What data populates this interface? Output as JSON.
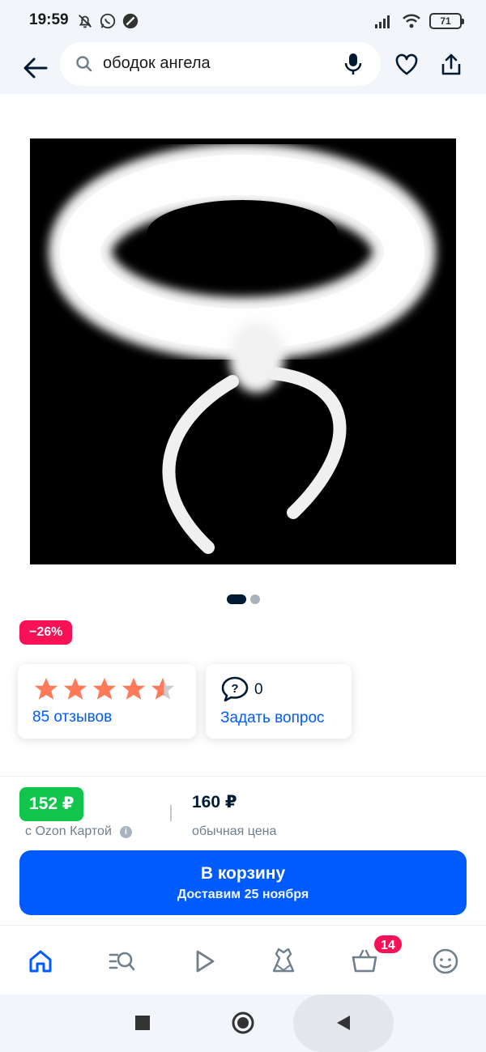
{
  "status_bar": {
    "time": "19:59",
    "battery": "71",
    "icons": [
      "mute-bell-icon",
      "whatsapp-icon",
      "slash-circle-icon",
      "signal-icon",
      "wifi-icon",
      "battery-icon"
    ]
  },
  "header": {
    "search_query": "ободок ангела",
    "icons": [
      "back-arrow-icon",
      "search-icon",
      "microphone-icon",
      "heart-icon",
      "share-icon"
    ]
  },
  "gallery": {
    "image_subject": "white feather angel halo headband",
    "current_page": 1,
    "total_pages": 2
  },
  "product": {
    "discount": "−26%",
    "rating": 4.5,
    "rating_max": 5,
    "reviews_label": "85 отзывов",
    "questions_count": "0",
    "ask_question_label": "Задать вопрос"
  },
  "price": {
    "ozon_card_price": "152 ₽",
    "ozon_card_label": "с Ozon Картой",
    "regular_price": "160 ₽",
    "regular_label": "обычная цена"
  },
  "cart_button": {
    "title": "В корзину",
    "subtitle": "Доставим 25 ноября"
  },
  "bottom_nav": {
    "items": [
      "home-icon",
      "catalog-icon",
      "video-icon",
      "fashion-icon",
      "cart-icon",
      "profile-icon"
    ],
    "cart_badge": "14"
  },
  "colors": {
    "accent": "#005bff",
    "green_price": "#10c44c",
    "badge_pink": "#f91155",
    "star_orange": "#ff7a59"
  }
}
